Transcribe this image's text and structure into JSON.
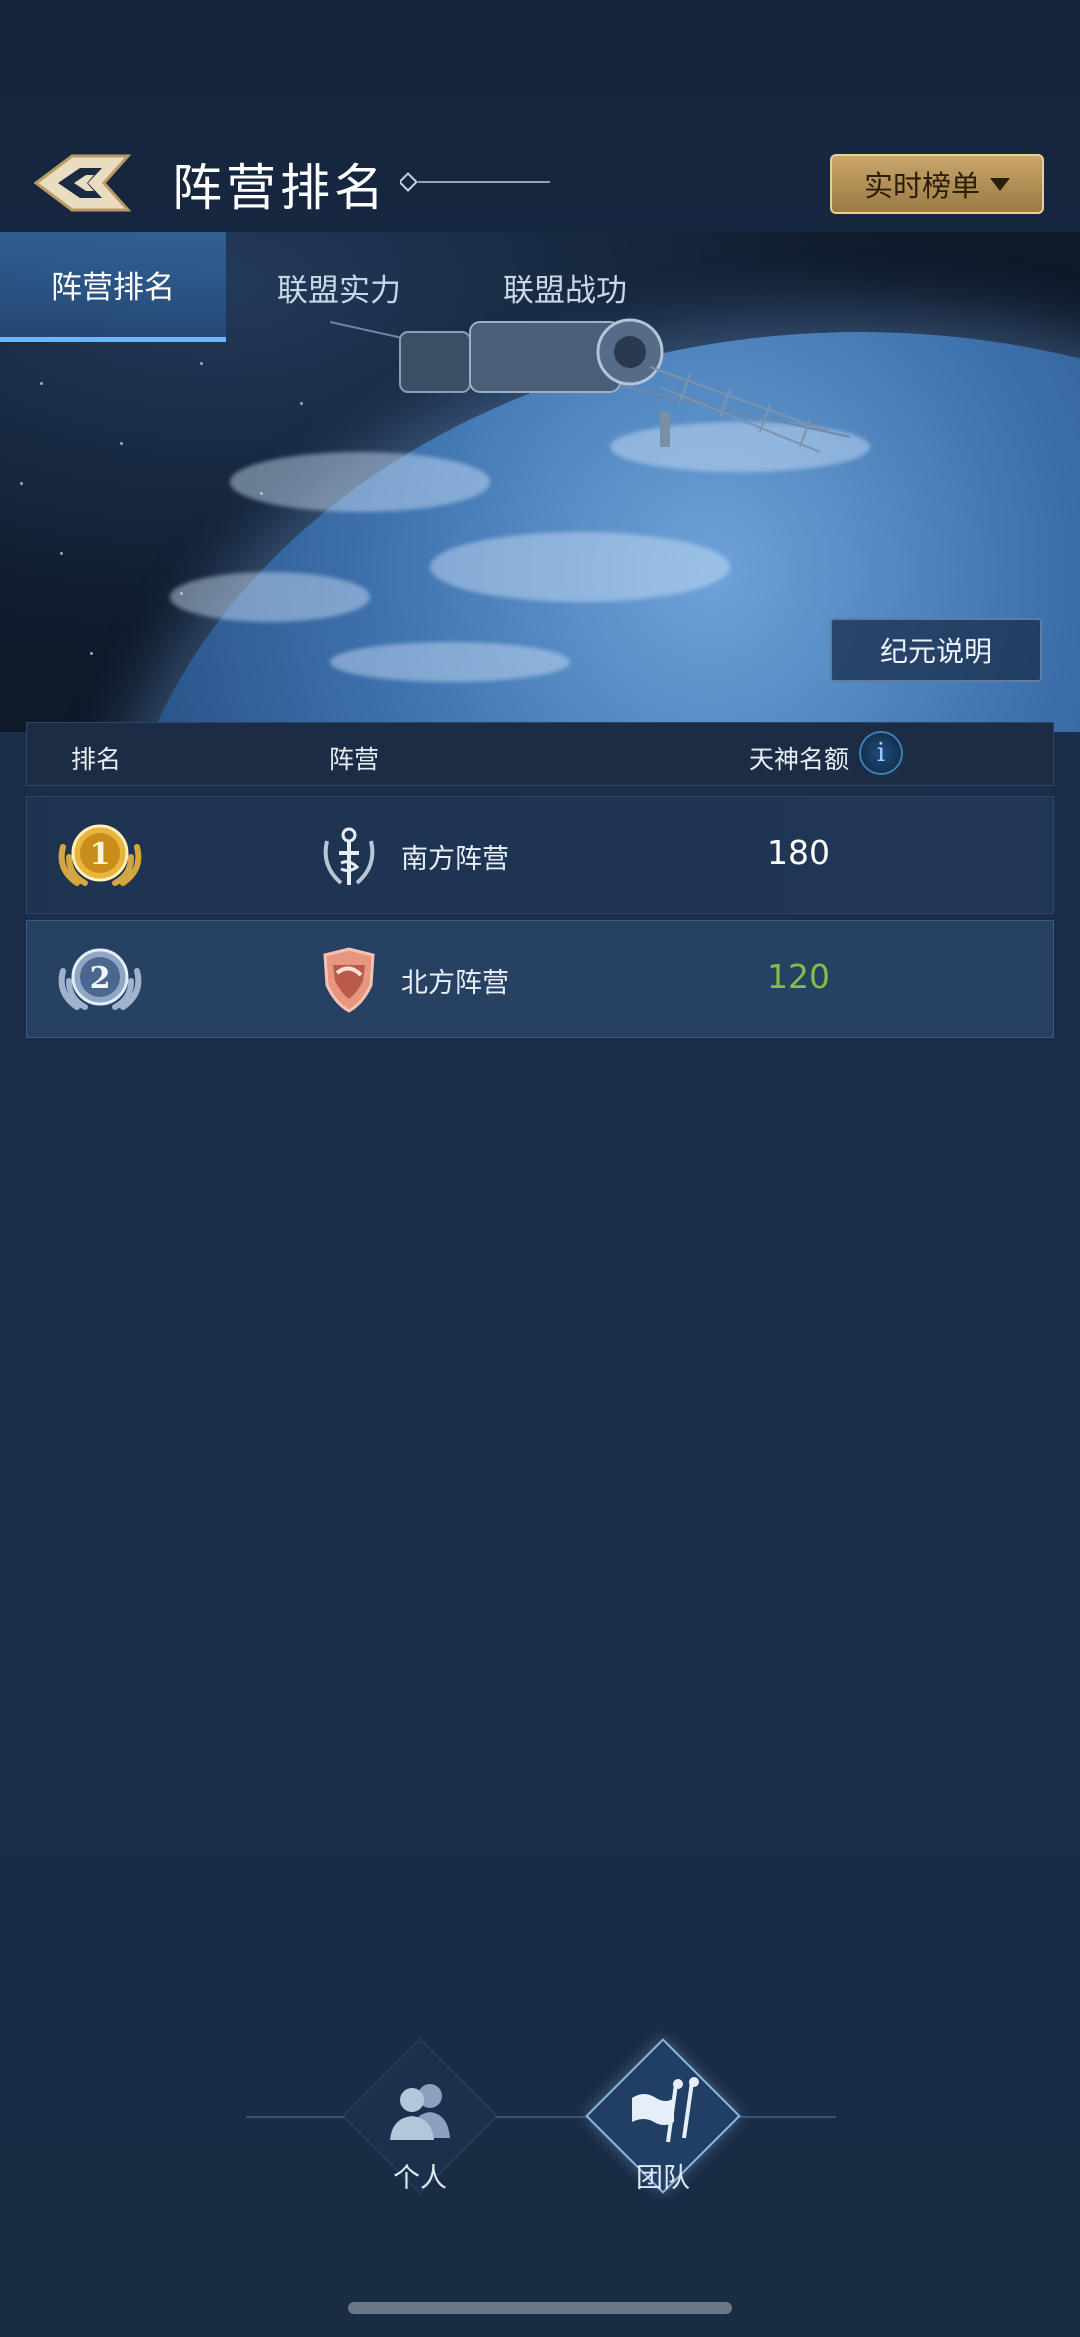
{
  "header": {
    "title": "阵营排名",
    "realtime_button": "实时榜单"
  },
  "tabs": [
    {
      "label": "阵营排名",
      "active": true
    },
    {
      "label": "联盟实力",
      "active": false
    },
    {
      "label": "联盟战功",
      "active": false
    }
  ],
  "banner": {
    "era_button": "纪元说明"
  },
  "table": {
    "headers": {
      "rank": "排名",
      "faction": "阵营",
      "quota": "天神名额"
    },
    "rows": [
      {
        "rank": "1",
        "faction": "南方阵营",
        "quota": "180",
        "quota_color": "#ffffff"
      },
      {
        "rank": "2",
        "faction": "北方阵营",
        "quota": "120",
        "quota_color": "#7fbf4a"
      }
    ]
  },
  "bottom_nav": [
    {
      "label": "个人",
      "icon": "people-icon"
    },
    {
      "label": "团队",
      "icon": "team-flag-icon",
      "active": true
    }
  ],
  "colors": {
    "accent": "#6fb4ff",
    "gold": "#c9a66a",
    "background": "#1b2d48"
  }
}
